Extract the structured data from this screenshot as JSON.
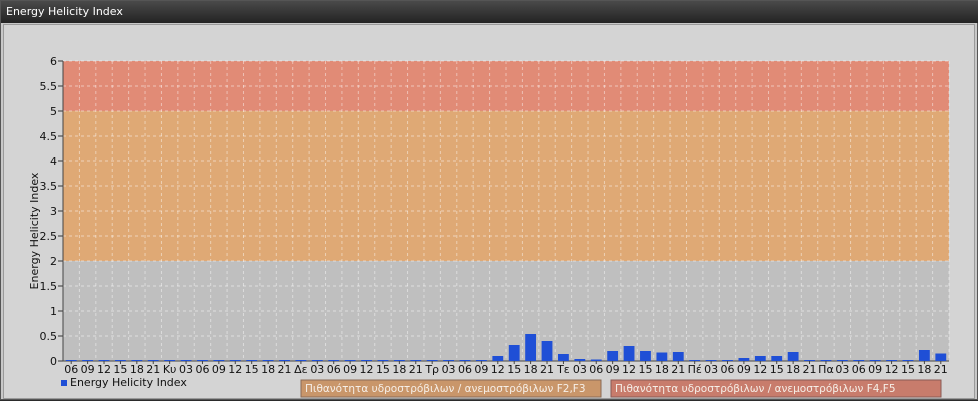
{
  "window": {
    "title": "Energy Helicity Index"
  },
  "legend": {
    "series_label": "Energy Helicity Index",
    "band_f2f3": "Πιθανότητα υδροστρόβιλων / ανεμοστρόβιλων F2,F3",
    "band_f4f5": "Πιθανότητα υδροστρόβιλων / ανεμοστρόβιλων F4,F5"
  },
  "colors": {
    "bar": "#1f4fd6",
    "band_low": "#bdbdbd",
    "band_f2f3": "#e0a46a",
    "band_f4f5": "#e2836c",
    "legend_f2f3_fill": "#c9966a",
    "legend_f4f5_fill": "#c87c6c"
  },
  "chart_data": {
    "type": "bar",
    "title": "",
    "xlabel": "",
    "ylabel": "Energy Helicity Index",
    "ylim": [
      0,
      6
    ],
    "yticks": [
      0,
      0.5,
      1,
      1.5,
      2,
      2.5,
      3,
      3.5,
      4,
      4.5,
      5,
      5.5,
      6
    ],
    "grid": true,
    "bands": [
      {
        "from": 0,
        "to": 2,
        "color": "#bdbdbd"
      },
      {
        "from": 2,
        "to": 5,
        "color": "#e0a46a",
        "label": "Πιθανότητα υδροστρόβιλων / ανεμοστρόβιλων F2,F3"
      },
      {
        "from": 5,
        "to": 6,
        "color": "#e2836c",
        "label": "Πιθανότητα υδροστρόβιλων / ανεμοστρόβιλων F4,F5"
      }
    ],
    "categories": [
      "06",
      "09",
      "12",
      "15",
      "18",
      "21",
      "Κυ",
      "03",
      "06",
      "09",
      "12",
      "15",
      "18",
      "21",
      "Δε",
      "03",
      "06",
      "09",
      "12",
      "15",
      "18",
      "21",
      "Τρ",
      "03",
      "06",
      "09",
      "12",
      "15",
      "18",
      "21",
      "Τε",
      "03",
      "06",
      "09",
      "12",
      "15",
      "18",
      "21",
      "Πέ",
      "03",
      "06",
      "09",
      "12",
      "15",
      "18",
      "21",
      "Πα",
      "03",
      "06",
      "09",
      "12",
      "15",
      "18",
      "21"
    ],
    "series": [
      {
        "name": "Energy Helicity Index",
        "values": [
          0.02,
          0.02,
          0.02,
          0.02,
          0.02,
          0.02,
          0.02,
          0.02,
          0.02,
          0.02,
          0.02,
          0.02,
          0.02,
          0.02,
          0.02,
          0.02,
          0.02,
          0.02,
          0.02,
          0.02,
          0.02,
          0.02,
          0.02,
          0.02,
          0.02,
          0.02,
          0.1,
          0.32,
          0.54,
          0.4,
          0.14,
          0.04,
          0.03,
          0.2,
          0.3,
          0.2,
          0.17,
          0.18,
          0.02,
          0.02,
          0.02,
          0.06,
          0.1,
          0.1,
          0.18,
          0.02,
          0.02,
          0.02,
          0.02,
          0.02,
          0.02,
          0.02,
          0.22,
          0.15
        ]
      }
    ]
  }
}
